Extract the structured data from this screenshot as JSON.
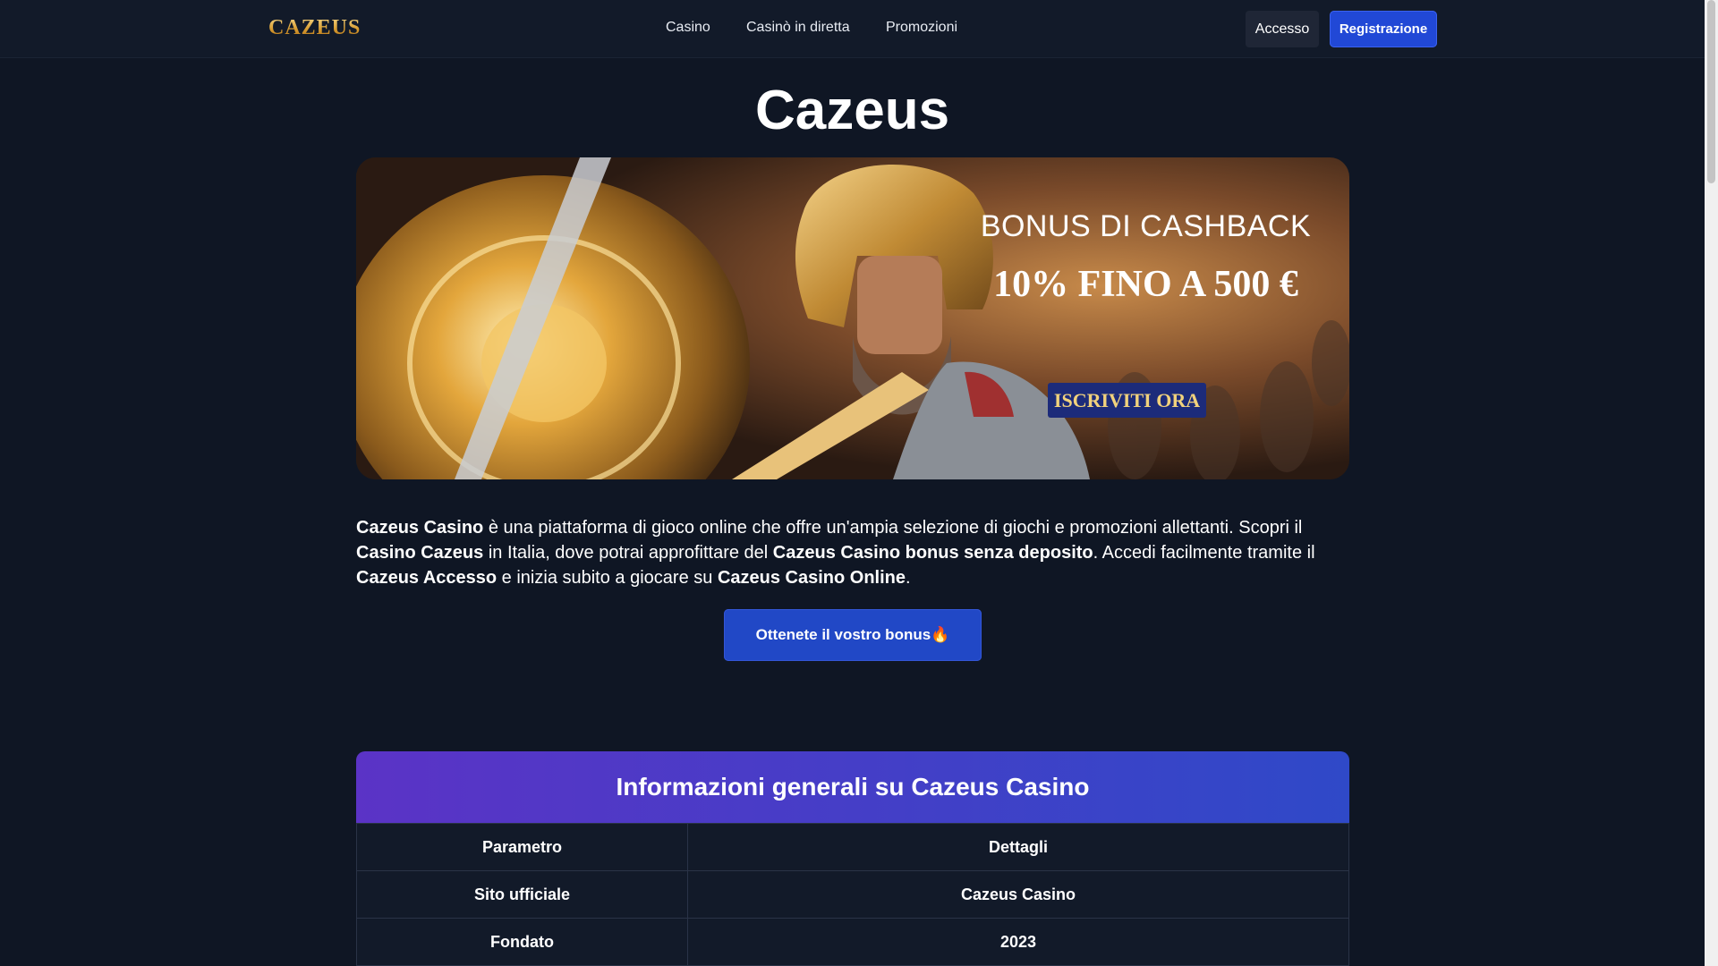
{
  "header": {
    "logo_text": "CAZEUS",
    "nav": [
      "Casino",
      "Casinò in diretta",
      "Promozioni"
    ],
    "login_label": "Accesso",
    "register_label": "Registrazione"
  },
  "main": {
    "title": "Cazeus",
    "banner": {
      "headline": "BONUS DI CASHBACK",
      "offer": "10% FINO A 500 €",
      "cta": "ISCRIVITI ORA"
    },
    "intro": {
      "s1_bold": "Cazeus Casino",
      "s1_text": " è una piattaforma di gioco online che offre un'ampia selezione di giochi e promozioni allettanti. Scopri il ",
      "s2_bold": "Casino Cazeus",
      "s2_text": " in Italia, dove potrai approfittare del ",
      "s3_bold": "Cazeus Casino bonus senza deposito",
      "s3_text": ". Accedi facilmente tramite il ",
      "s4_bold": "Cazeus Accesso",
      "s4_text": " e inizia subito a giocare su ",
      "s5_bold": "Cazeus Casino Online",
      "s5_text": "."
    },
    "bonus_button": "Ottenete il vostro bonus🔥"
  },
  "info_table": {
    "title": "Informazioni generali su Cazeus Casino",
    "headers": [
      "Parametro",
      "Dettagli"
    ],
    "rows": [
      [
        "Sito ufficiale",
        "Cazeus Casino"
      ],
      [
        "Fondato",
        "2023"
      ]
    ]
  },
  "colors": {
    "background": "#0f1624",
    "header": "#121a29",
    "accent_blue": "#2148d6",
    "gold": "#e0b04a",
    "table_header_gradient": [
      "#5b33c6",
      "#2f49c8"
    ]
  }
}
